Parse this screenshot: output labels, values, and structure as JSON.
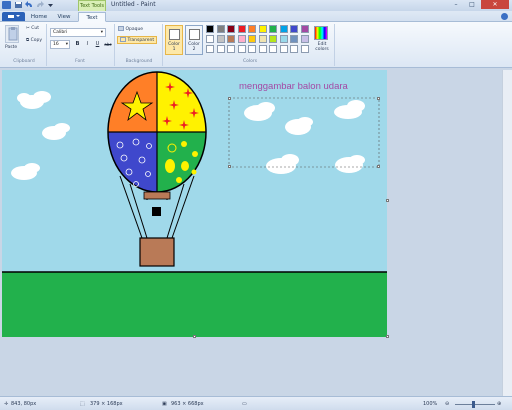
{
  "window": {
    "context_tab": "Text Tools",
    "title": "Untitled - Paint",
    "min": "–",
    "max": "□",
    "close": "✕"
  },
  "tabs": [
    {
      "label": "Home"
    },
    {
      "label": "View"
    },
    {
      "label": "Text"
    }
  ],
  "ribbon": {
    "clipboard": {
      "paste": "Paste",
      "cut": "Cut",
      "copy": "Copy",
      "group": "Clipboard"
    },
    "font": {
      "family": "Calibri",
      "size": "16",
      "bold": "B",
      "italic": "I",
      "underline": "U",
      "strike": "abc",
      "group": "Font"
    },
    "background": {
      "opaque": "Opaque",
      "transparent": "Transparent",
      "group": "Background"
    },
    "colors": {
      "color1": "Color 1",
      "color2": "Color 2",
      "edit": "Edit colors",
      "group": "Colors",
      "color1_value": "#ffffff",
      "color2_value": "#ffffff",
      "row1": [
        "#000000",
        "#7f7f7f",
        "#880015",
        "#ed1c24",
        "#ff7f27",
        "#fff200",
        "#22b14c",
        "#00a2e8",
        "#3f48cc",
        "#a349a4"
      ],
      "row2": [
        "#ffffff",
        "#c3c3c3",
        "#b97a57",
        "#ffaec9",
        "#ffc90e",
        "#efe4b0",
        "#b5e61d",
        "#99d9ea",
        "#7092be",
        "#c8bfe7"
      ],
      "row3": [
        "#ffffff",
        "#ffffff",
        "#ffffff",
        "#ffffff",
        "#ffffff",
        "#ffffff",
        "#ffffff",
        "#ffffff",
        "#ffffff",
        "#ffffff"
      ]
    }
  },
  "canvas": {
    "text": "menggambar balon udara",
    "sky": "#a0d9ea",
    "ground": "#22b14c",
    "balloon_colors": {
      "tl": "#ff7f27",
      "tr": "#fff200",
      "bl": "#3f48cc",
      "br": "#22b14c"
    }
  },
  "status": {
    "cursor": "843, 80px",
    "selection": "379 × 168px",
    "size": "963 × 668px",
    "zoom": "100%"
  }
}
